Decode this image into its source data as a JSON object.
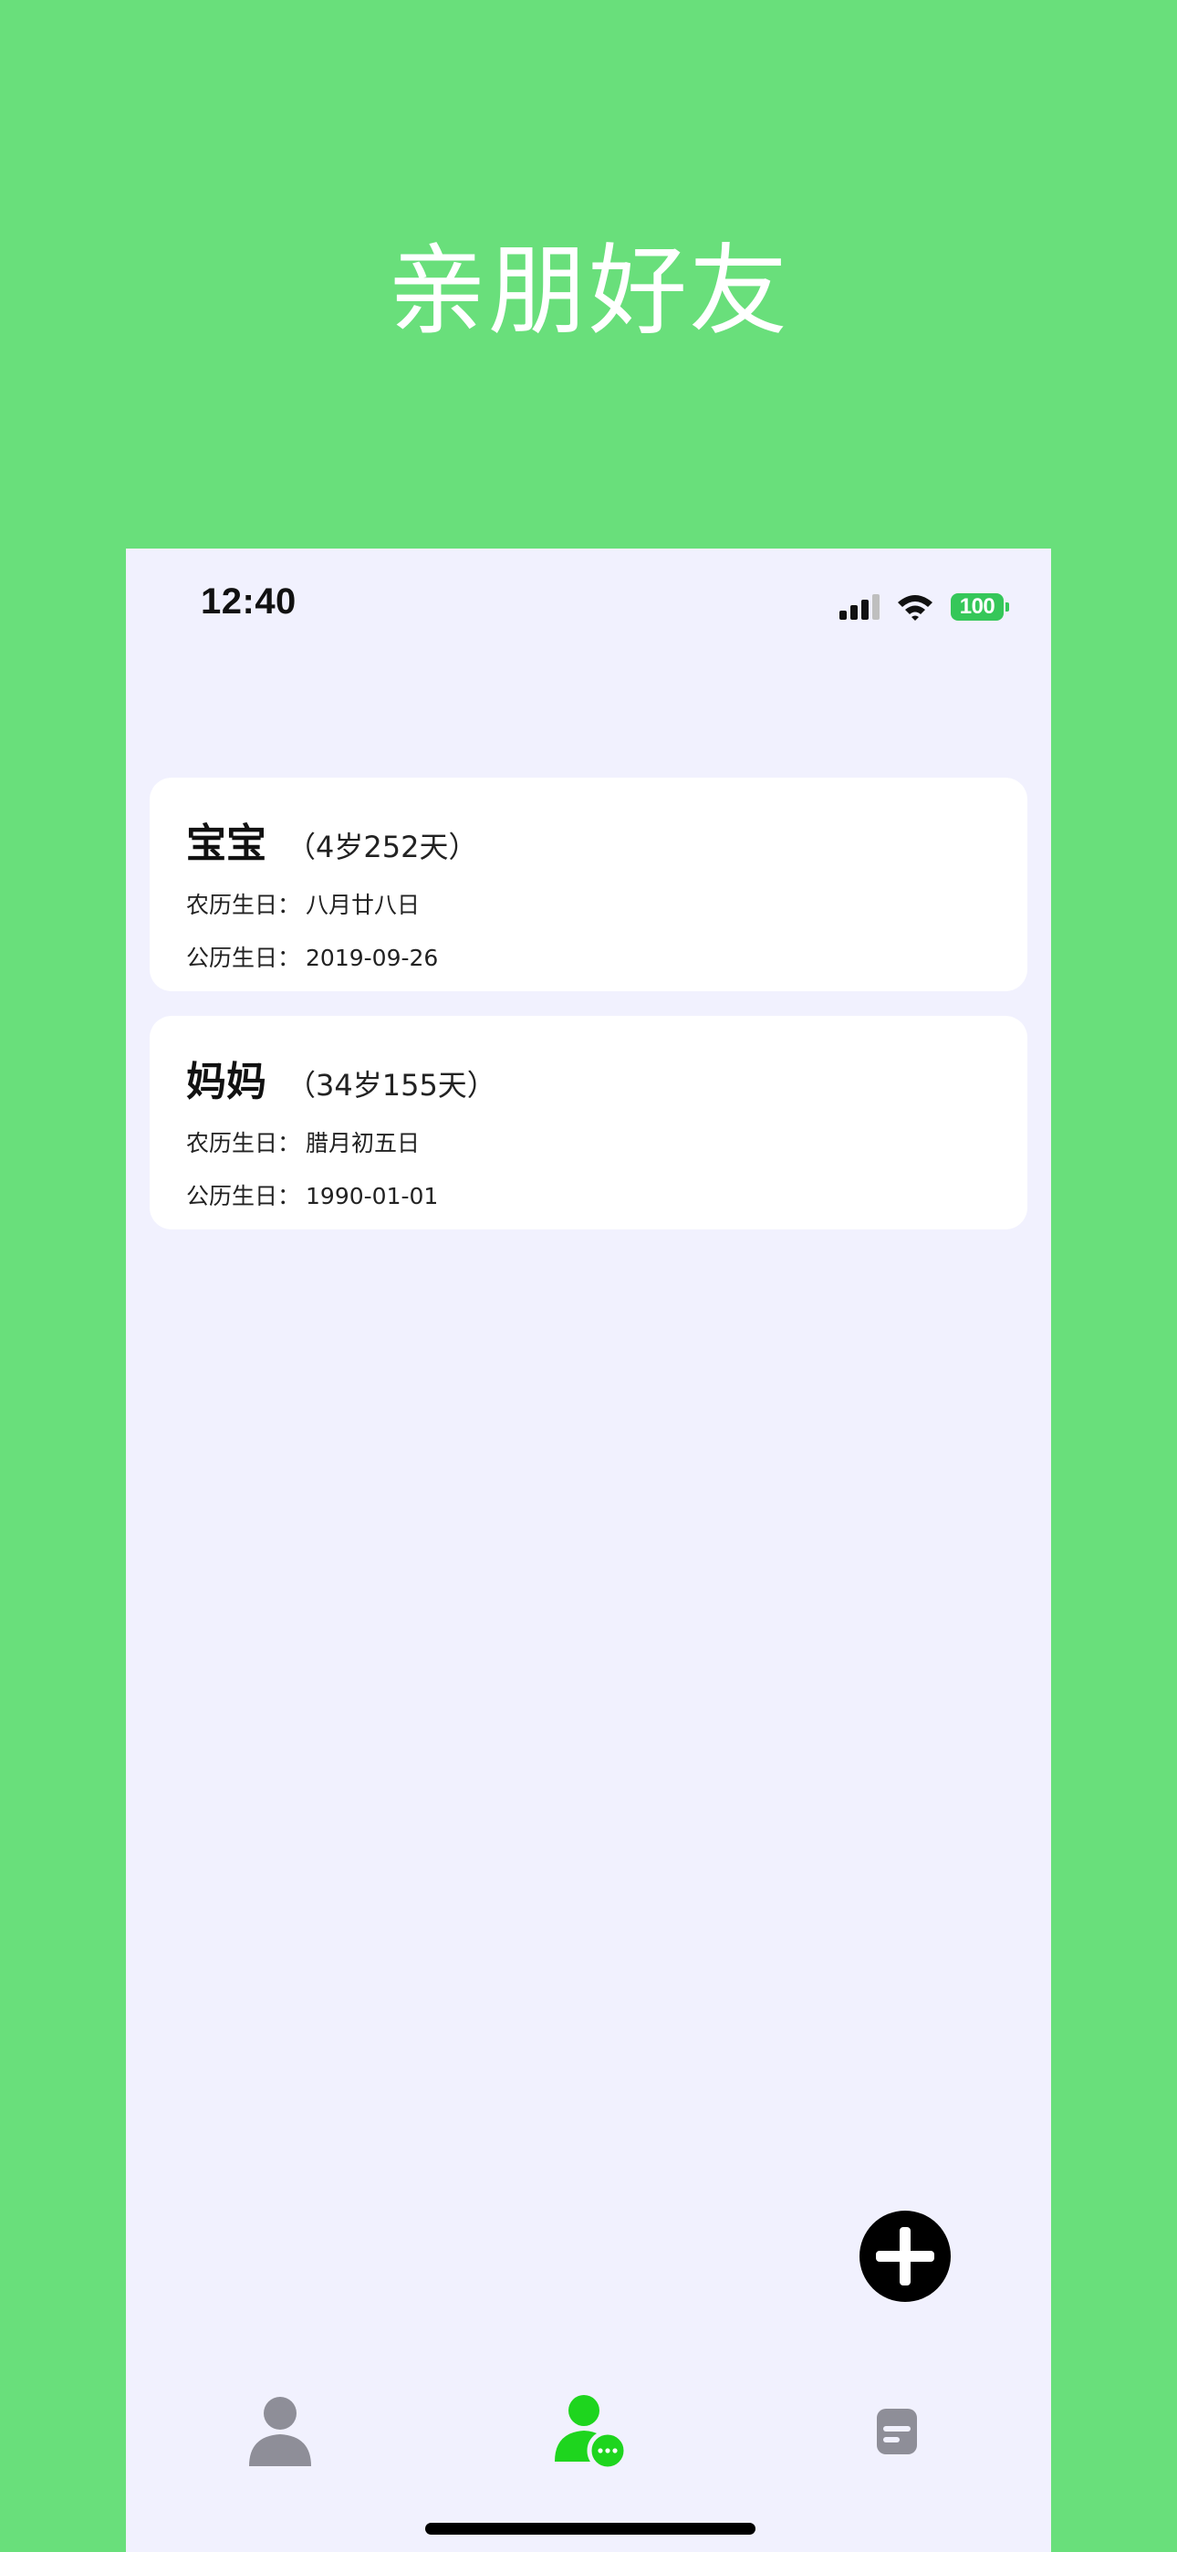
{
  "hero": {
    "title": "亲朋好友"
  },
  "status_bar": {
    "time": "12:40",
    "battery": "100"
  },
  "contacts": [
    {
      "name": "宝宝",
      "age": "（4岁252天）",
      "lunar_label": "农历生日：",
      "lunar_value": "八月廿八日",
      "solar_label": "公历生日：",
      "solar_value": "2019-09-26"
    },
    {
      "name": "妈妈",
      "age": "（34岁155天）",
      "lunar_label": "农历生日：",
      "lunar_value": "腊月初五日",
      "solar_label": "公历生日：",
      "solar_value": "1990-01-01"
    }
  ],
  "fab": {
    "icon": "plus-icon"
  },
  "tab_bar": [
    {
      "icon": "person-icon",
      "active": false
    },
    {
      "icon": "person-chat-icon",
      "active": true
    },
    {
      "icon": "note-icon",
      "active": false
    }
  ],
  "colors": {
    "background": "#69df7b",
    "screen": "#f1f1fe",
    "active_tab": "#1ed51e",
    "inactive_tab": "#8e8e98",
    "battery": "#35c759"
  }
}
